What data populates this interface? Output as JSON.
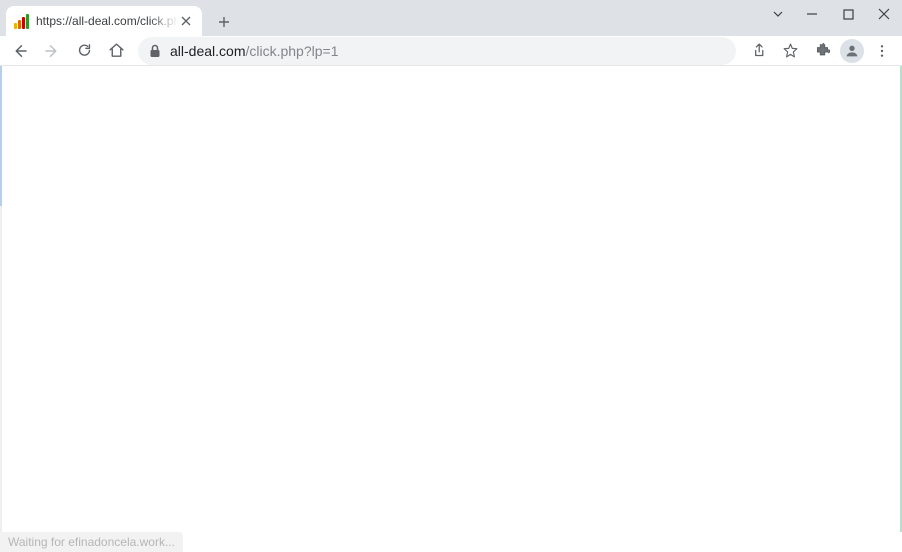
{
  "window": {
    "tab_title": "https://all-deal.com/click.php?lp",
    "controls": {
      "dropdown": "˅",
      "minimize": "—",
      "maximize": "▢",
      "close": "✕"
    },
    "new_tab": "+",
    "tab_close": "✕"
  },
  "toolbar": {
    "url_host": "all-deal.com",
    "url_path": "/click.php?lp=1"
  },
  "status": {
    "text": "Waiting for efinadoncela.work..."
  }
}
